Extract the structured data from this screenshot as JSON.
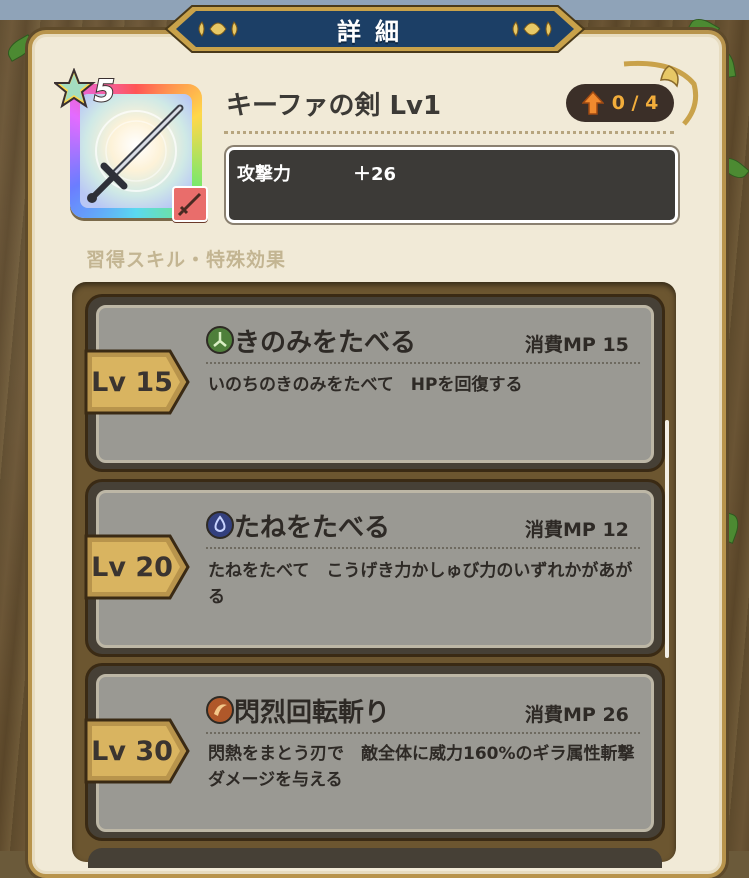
{
  "header": {
    "title": "詳細"
  },
  "item": {
    "rarity_stars": "5",
    "name": "キーファの剣 Lv1",
    "upgrade": "0 / 4",
    "stats": [
      {
        "name": "攻撃力",
        "value": "＋26"
      }
    ]
  },
  "skills_section": {
    "label": "習得スキル・特殊効果",
    "skills": [
      {
        "level": "Lv 15",
        "icon": "leaf-element-icon",
        "icon_color": "#4e7f3a",
        "name": "きのみをたべる",
        "mp": "消費MP 15",
        "description": "いのちのきのみをたべて　HPを回復する"
      },
      {
        "level": "Lv 20",
        "icon": "water-element-icon",
        "icon_color": "#33407e",
        "name": "たねをたべる",
        "mp": "消費MP 12",
        "description": "たねをたべて　こうげき力かしゅび力のいずれかがあがる"
      },
      {
        "level": "Lv 30",
        "icon": "slash-element-icon",
        "icon_color": "#b0582a",
        "name": "閃烈回転斬り",
        "mp": "消費MP 26",
        "description": "閃熱をまとう刃で　敵全体に威力160%のギラ属性斬撃ダメージを与える"
      }
    ]
  },
  "colors": {
    "panel": "#f1ead7",
    "banner": "#1c3f66",
    "gold": "#c9a24a",
    "stat_box": "#3c3a37",
    "upgrade_accent": "#f2ad3b"
  }
}
